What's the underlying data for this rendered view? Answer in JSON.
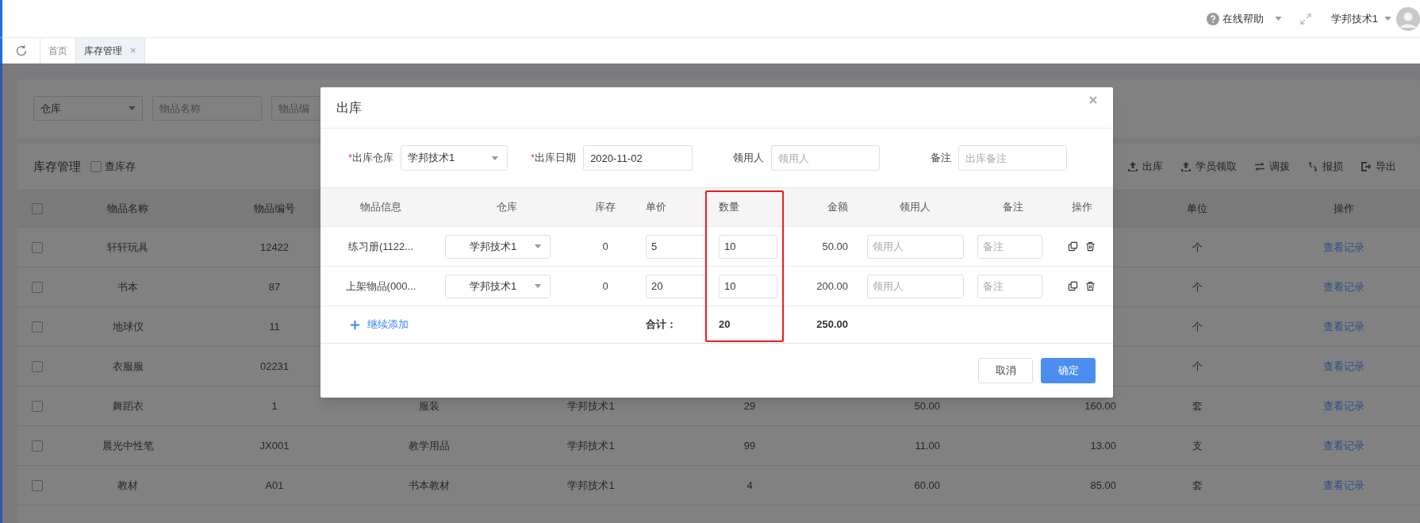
{
  "header": {
    "help": "在线帮助",
    "user": "学邦技术1"
  },
  "tabs": [
    {
      "label": "首页",
      "selected": false
    },
    {
      "label": "库存管理",
      "selected": true,
      "close": "×"
    }
  ],
  "filters": [
    {
      "kind": "select",
      "value": "仓库"
    },
    {
      "kind": "input",
      "placeholder": "物品名称"
    },
    {
      "kind": "input",
      "placeholder": "物品编"
    }
  ],
  "panel": {
    "title": "库存管理",
    "check_stock": {
      "label": "查库存",
      "checked": false
    },
    "actions": [
      {
        "kind": "upload",
        "label": "出库"
      },
      {
        "kind": "upload",
        "label": "学员领取"
      },
      {
        "kind": "transfer",
        "label": "调拨"
      },
      {
        "kind": "broken",
        "label": "报损"
      },
      {
        "kind": "export",
        "label": "导出"
      }
    ]
  },
  "table": {
    "all_checked": false,
    "columns": {
      "name": "物品名称",
      "code": "物品编号",
      "unit": "单位",
      "action": "操作"
    },
    "rows": [
      {
        "checked": false,
        "name": "轩轩玩具",
        "code": "12422",
        "unit": "个",
        "action": "查看记录"
      },
      {
        "checked": false,
        "name": "书本",
        "code": "87",
        "unit": "个",
        "action": "查看记录"
      },
      {
        "checked": false,
        "name": "地球仪",
        "code": "11",
        "unit": "个",
        "action": "查看记录"
      },
      {
        "checked": false,
        "name": "衣服服",
        "code": "02231",
        "unit": "个",
        "action": "查看记录"
      },
      {
        "checked": false,
        "name": "舞蹈衣",
        "code": "1",
        "column_3": "服装",
        "column_4": "学邦技术1",
        "column_5": "29",
        "column_6": "50.00",
        "column_7": "160.00",
        "unit": "套",
        "action": "查看记录"
      },
      {
        "checked": false,
        "name": "晨光中性笔",
        "code": "JX001",
        "column_3": "教学用品",
        "column_4": "学邦技术1",
        "column_5": "99",
        "column_6": "11.00",
        "column_7": "13.00",
        "unit": "支",
        "action": "查看记录"
      },
      {
        "checked": false,
        "name": "教材",
        "code": "A01",
        "column_3": "书本教材",
        "column_4": "学邦技术1",
        "column_5": "4",
        "column_6": "60.00",
        "column_7": "85.00",
        "unit": "套",
        "action": "查看记录"
      }
    ]
  },
  "dialog": {
    "title": "出库",
    "form": [
      {
        "label": "出库仓库",
        "required_mark": "*",
        "kind": "select",
        "value": "学邦技术1"
      },
      {
        "label": "出库日期",
        "required_mark": "*",
        "kind": "input",
        "value": "2020-11-02"
      },
      {
        "label": "领用人",
        "kind": "input",
        "placeholder": "领用人"
      },
      {
        "label": "备注",
        "kind": "input",
        "placeholder": "出库备注"
      }
    ],
    "columns": [
      {
        "label": "物品信息",
        "highlighted": false
      },
      {
        "label": "仓库",
        "highlighted": false
      },
      {
        "label": "库存",
        "highlighted": false
      },
      {
        "label": "单价",
        "highlighted": false
      },
      {
        "label": "数量",
        "highlighted": true
      },
      {
        "label": "金额",
        "highlighted": false
      },
      {
        "label": "领用人",
        "highlighted": false
      },
      {
        "label": "备注",
        "highlighted": false
      },
      {
        "label": "操作",
        "highlighted": false
      }
    ],
    "items": [
      {
        "name": "练习册(1122...",
        "warehouse": "学邦技术1",
        "stock": "0",
        "price": "5",
        "quantity": "10",
        "amount": "50.00",
        "recipient_placeholder": "领用人",
        "note_placeholder": "备注"
      },
      {
        "name": "上架物品(000...",
        "warehouse": "学邦技术1",
        "stock": "0",
        "price": "20",
        "quantity": "10",
        "amount": "200.00",
        "recipient_placeholder": "领用人",
        "note_placeholder": "备注"
      }
    ],
    "footer": {
      "add": "继续添加",
      "total_label": "合计：",
      "total_quantity": "20",
      "total_amount": "250.00"
    },
    "buttons": [
      {
        "label": "取消",
        "primary": false
      },
      {
        "label": "确定",
        "primary": true
      }
    ]
  }
}
